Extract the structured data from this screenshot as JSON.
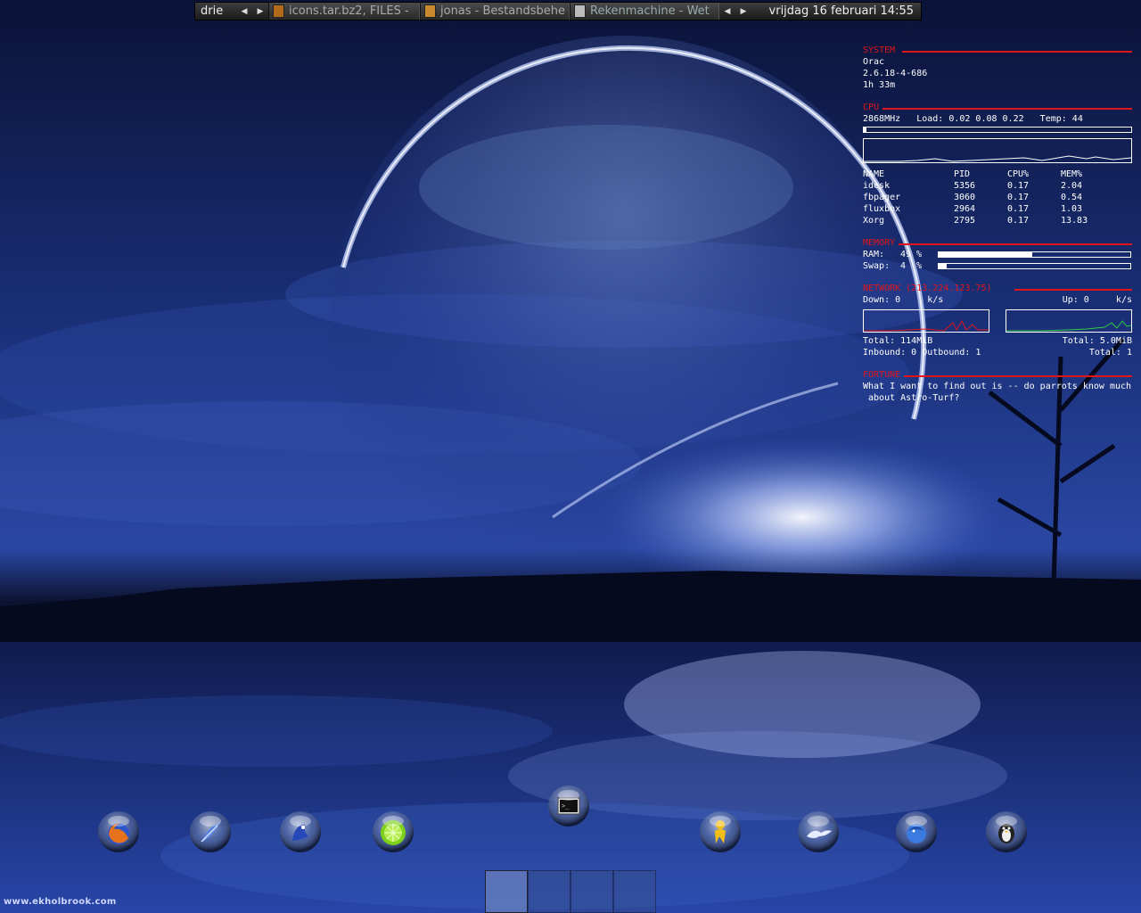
{
  "toolbar": {
    "workspace_name": "drie",
    "tasks": [
      {
        "label": "icons.tar.bz2, FILES -"
      },
      {
        "label": "jonas - Bestandsbehe"
      },
      {
        "label": "Rekenmachine  - Wet"
      }
    ],
    "clock": "vrijdag 16 februari 14:55"
  },
  "conky": {
    "system": {
      "header": "SYSTEM",
      "hostname": "Orac",
      "kernel": "2.6.18-4-686",
      "uptime": "1h 33m"
    },
    "cpu": {
      "header": "CPU",
      "info_line": "2868MHz   Load: 0.02 0.08 0.22   Temp: 44",
      "usage": 0.01,
      "columns": [
        "NAME",
        "PID",
        "CPU%",
        "MEM%"
      ],
      "processes": [
        {
          "name": "idesk",
          "pid": "5356",
          "cpu": "0.17",
          "mem": "2.04"
        },
        {
          "name": "fbpager",
          "pid": "3060",
          "cpu": "0.17",
          "mem": "0.54"
        },
        {
          "name": "fluxbox",
          "pid": "2964",
          "cpu": "0.17",
          "mem": "1.03"
        },
        {
          "name": "Xorg",
          "pid": "2795",
          "cpu": "0.17",
          "mem": "13.83"
        }
      ]
    },
    "memory": {
      "header": "MEMORY",
      "ram_label": "RAM:",
      "ram_value": "49 %",
      "ram_fraction": 0.49,
      "swap_label": "Swap:",
      "swap_value": "4  %",
      "swap_fraction": 0.04
    },
    "network": {
      "header": "NETWORK (213.224.123.75)",
      "down_label": "Down: 0     k/s",
      "up_label": "Up: 0     k/s",
      "total_down": "Total: 114MiB",
      "total_up": "Total: 5.0MiB",
      "inbound_outbound": "Inbound: 0 Outbound: 1",
      "total_conn": "Total: 1",
      "down_color": "#e0151b",
      "up_color": "#2ecc40"
    },
    "fortune": {
      "header": "FORTUNE",
      "line1": "What I want to find out is -- do parrots know much",
      "line2": " about Astro-Turf?"
    }
  },
  "dock": {
    "icons": [
      {
        "name": "firefox-icon"
      },
      {
        "name": "feather-mail-icon"
      },
      {
        "name": "blue-bird-icon"
      },
      {
        "name": "lime-icon"
      },
      {
        "name": "terminal-icon"
      },
      {
        "name": "aim-buddy-icon"
      },
      {
        "name": "openoffice-icon"
      },
      {
        "name": "thunderbird-icon"
      },
      {
        "name": "penguin-icon"
      }
    ]
  },
  "pager": {
    "workspaces": 4,
    "active": 0
  },
  "watermark": "www.ekholbrook.com"
}
